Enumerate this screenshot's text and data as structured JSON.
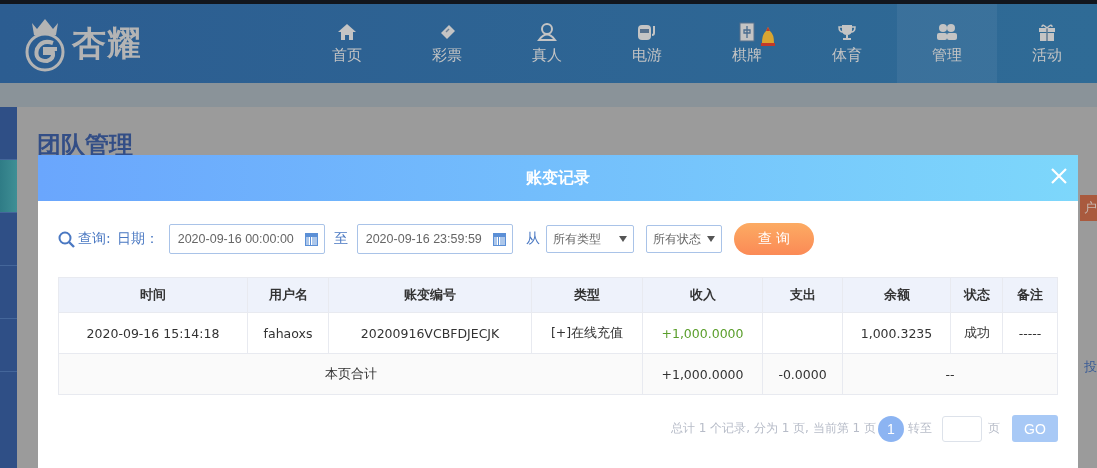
{
  "header": {
    "logo": "杏耀",
    "nav": [
      {
        "label": "首页",
        "selected": false,
        "alert": false
      },
      {
        "label": "彩票",
        "selected": false,
        "alert": false
      },
      {
        "label": "真人",
        "selected": false,
        "alert": false
      },
      {
        "label": "电游",
        "selected": false,
        "alert": false
      },
      {
        "label": "棋牌",
        "selected": false,
        "alert": true
      },
      {
        "label": "体育",
        "selected": false,
        "alert": false
      },
      {
        "label": "管理",
        "selected": true,
        "alert": false
      },
      {
        "label": "活动",
        "selected": false,
        "alert": false
      }
    ]
  },
  "page": {
    "sidebar": [
      {
        "selected": false
      },
      {
        "selected": true
      },
      {
        "selected": false
      },
      {
        "selected": false
      },
      {
        "selected": false
      }
    ],
    "title": "团队管理",
    "side_labels": [
      "户",
      "投"
    ]
  },
  "dialog": {
    "title": "账变记录",
    "filter": {
      "query_label": "查询:",
      "date_label": "日期：",
      "start": "2020-09-16 00:00:00",
      "to": "至",
      "end": "2020-09-16 23:59:59",
      "from": "从",
      "type_select": "所有类型",
      "status_select": "所有状态",
      "button": "查 询"
    },
    "table": {
      "columns": [
        "时间",
        "用户名",
        "账变编号",
        "类型",
        "收入",
        "支出",
        "余额",
        "状态",
        "备注"
      ],
      "rows": [
        {
          "kind": "record",
          "cells": [
            "2020-09-16 15:14:18",
            "fahaoxs",
            "20200916VCBFDJECJK",
            "[+]在线充值",
            "+1,000.0000",
            "",
            "1,000.3235",
            "成功",
            "-----"
          ]
        },
        {
          "kind": "total",
          "cells": [
            {
              "text": "本页合计",
              "colspan": 4
            },
            {
              "text": "+1,000.0000"
            },
            {
              "text": "-0.0000"
            },
            {
              "text": "--",
              "colspan": 3
            }
          ]
        }
      ]
    },
    "pagination": {
      "summary": "总计 1 个记录, 分为 1 页, 当前第 1 页",
      "page": "1",
      "goto": "转至",
      "unit": "页",
      "button": "GO"
    }
  }
}
